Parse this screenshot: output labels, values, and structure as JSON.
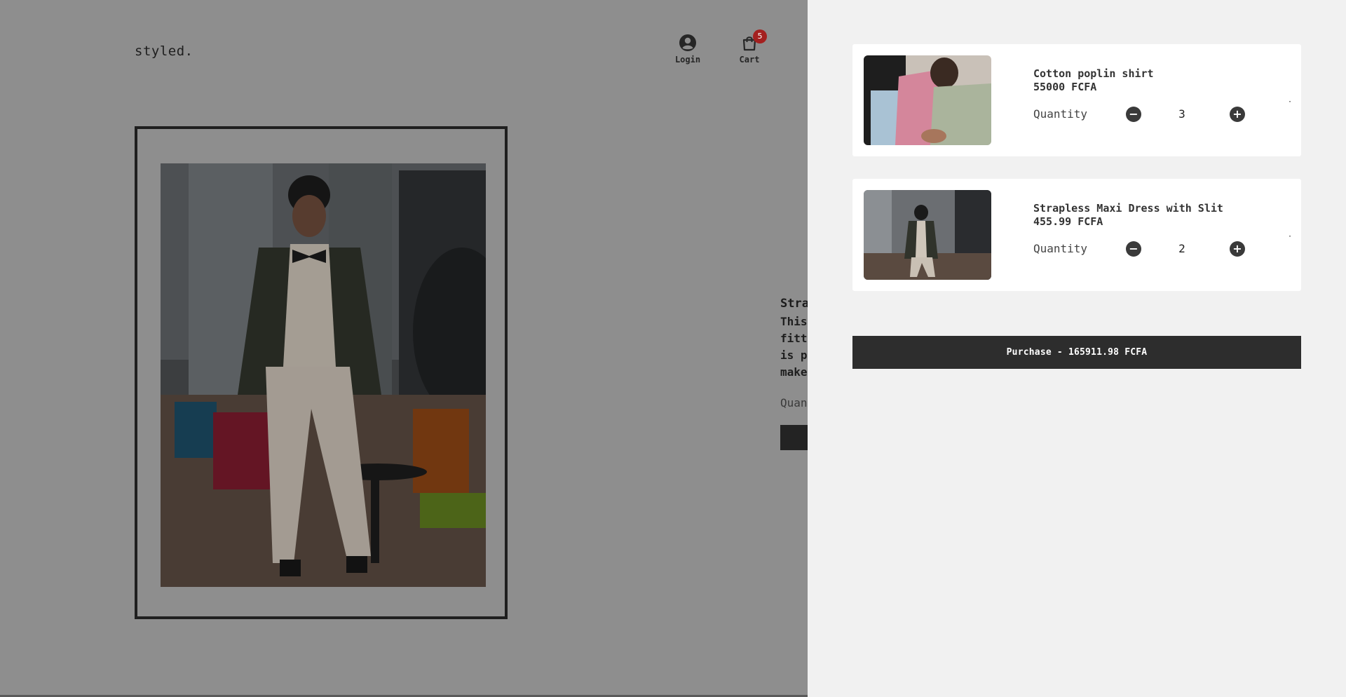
{
  "header": {
    "logo": "styled.",
    "login_label": "Login",
    "cart_label": "Cart",
    "cart_count": "5"
  },
  "product": {
    "title": "Strapless Maxi Dress with Slit",
    "description_lines": [
      "This",
      "fitt",
      "is p",
      "make"
    ],
    "quantity_label": "Quantity"
  },
  "cart": {
    "items": [
      {
        "name": "Cotton poplin shirt",
        "price": "55000 FCFA",
        "quantity_label": "Quantity",
        "quantity": "3",
        "remove_icon": "dot-icon"
      },
      {
        "name": "Strapless Maxi Dress with Slit",
        "price": "455.99 FCFA",
        "quantity_label": "Quantity",
        "quantity": "2",
        "remove_icon": "dot-icon"
      }
    ],
    "purchase_label": "Purchase - 165911.98 FCFA"
  },
  "colors": {
    "overlay": "#8e8e8e",
    "drawer": "#f1f1f1",
    "button": "#2d2d2d",
    "badge": "#a4201f"
  }
}
